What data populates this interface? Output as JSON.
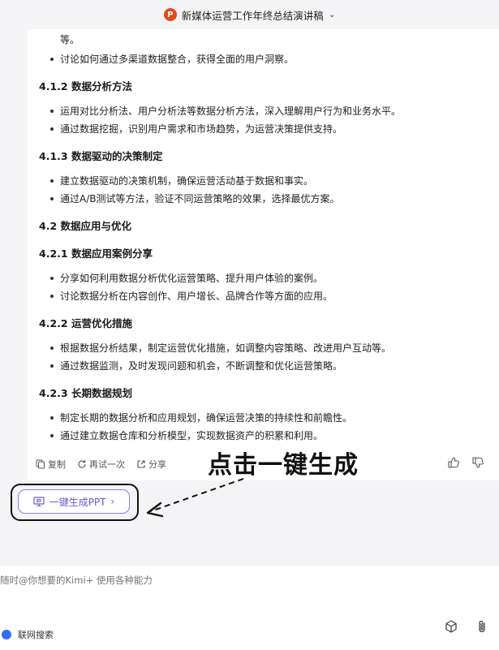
{
  "header": {
    "title": "新媒体运营工作年终总结演讲稿",
    "ppt_icon_name": "powerpoint-icon",
    "chevron": "⌄"
  },
  "content": {
    "top_fragment": "等。",
    "top_bullets": [
      "讨论如何通过多渠道数据整合，获得全面的用户洞察。"
    ],
    "sections": [
      {
        "heading": "4.1.2 数据分析方法",
        "bullets": [
          "运用对比分析法、用户分析法等数据分析方法，深入理解用户行为和业务水平。",
          "通过数据挖掘，识别用户需求和市场趋势，为运营决策提供支持。"
        ]
      },
      {
        "heading": "4.1.3 数据驱动的决策制定",
        "bullets": [
          "建立数据驱动的决策机制，确保运营活动基于数据和事实。",
          "通过A/B测试等方法，验证不同运营策略的效果，选择最优方案。"
        ]
      },
      {
        "heading": "4.2 数据应用与优化",
        "bullets": []
      },
      {
        "heading": "4.2.1 数据应用案例分享",
        "bullets": [
          "分享如何利用数据分析优化运营策略、提升用户体验的案例。",
          "讨论数据分析在内容创作、用户增长、品牌合作等方面的应用。"
        ]
      },
      {
        "heading": "4.2.2 运营优化措施",
        "bullets": [
          "根据数据分析结果，制定运营优化措施，如调整内容策略、改进用户互动等。",
          "通过数据监测，及时发现问题和机会，不断调整和优化运营策略。"
        ]
      },
      {
        "heading": "4.2.3 长期数据规划",
        "bullets": [
          "制定长期的数据分析和应用规划，确保运营决策的持续性和前瞻性。",
          "通过建立数据仓库和分析模型，实现数据资产的积累和利用。"
        ]
      }
    ]
  },
  "actions": {
    "copy": "复制",
    "retry": "再试一次",
    "share": "分享"
  },
  "annotation": {
    "text": "点击一键生成"
  },
  "ppt_button": {
    "label": "一键生成PPT",
    "chevron": "›"
  },
  "input": {
    "placeholder": "随时@你想要的Kimi+ 使用各种能力"
  },
  "footer": {
    "web_search_label": "联网搜索"
  },
  "colors": {
    "accent": "#6a57d4",
    "toggle": "#2f6bff",
    "ppt_icon": "#e64a19"
  }
}
